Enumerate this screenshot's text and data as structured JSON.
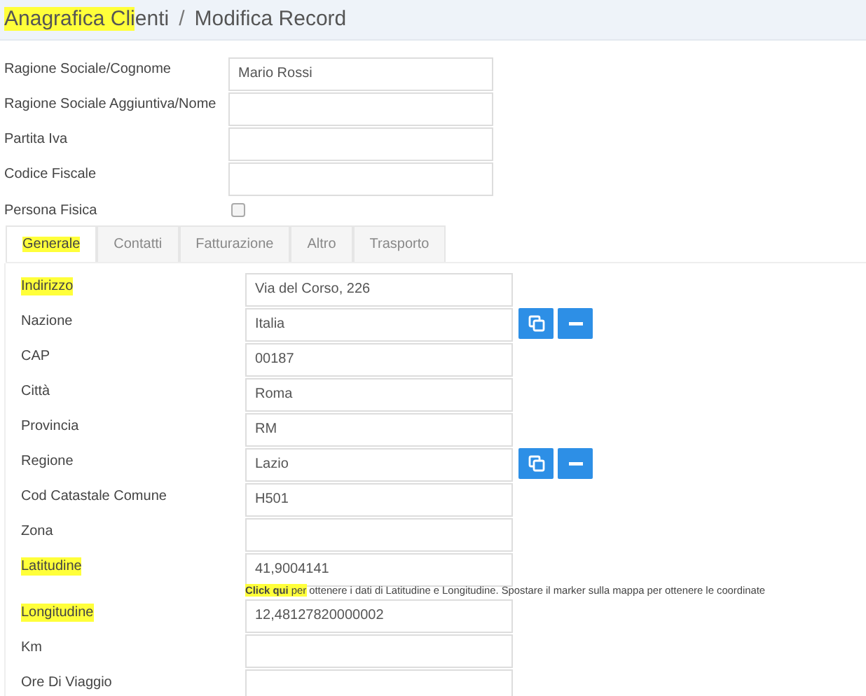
{
  "header": {
    "title_parts": [
      {
        "text": "Anagrafica Cli",
        "highlighted": true
      },
      {
        "text": "enti",
        "highlighted": false
      }
    ],
    "separator": "/",
    "subtitle": "Modifica Record"
  },
  "top_fields": [
    {
      "kind": "text",
      "label": "Ragione Sociale/Cognome",
      "value": "Mario Rossi"
    },
    {
      "kind": "text",
      "label": "Ragione Sociale Aggiuntiva/Nome"
    },
    {
      "kind": "text",
      "label": "Partita Iva"
    },
    {
      "kind": "text",
      "label": "Codice Fiscale"
    },
    {
      "kind": "checkbox",
      "label": "Persona Fisica",
      "checked": false
    }
  ],
  "tabs": [
    {
      "label": "Generale",
      "selected": true,
      "highlighted": true
    },
    {
      "label": "Contatti",
      "selected": false,
      "highlighted": false
    },
    {
      "label": "Fatturazione",
      "selected": false,
      "highlighted": false
    },
    {
      "label": "Altro",
      "selected": false,
      "highlighted": false
    },
    {
      "label": "Trasporto",
      "selected": false,
      "highlighted": false
    }
  ],
  "general_rows": [
    {
      "kind": "field",
      "label": "Indirizzo",
      "highlighted": true,
      "value": "Via del Corso, 226"
    },
    {
      "kind": "field",
      "label": "Nazione",
      "highlighted": false,
      "value": "Italia",
      "actions": [
        {
          "kind": "copy"
        },
        {
          "kind": "remove"
        }
      ]
    },
    {
      "kind": "field",
      "label": "CAP",
      "highlighted": false,
      "value": "00187"
    },
    {
      "kind": "field",
      "label": "Città",
      "highlighted": false,
      "value": "Roma"
    },
    {
      "kind": "field",
      "label": "Provincia",
      "highlighted": false,
      "value": "RM"
    },
    {
      "kind": "field",
      "label": "Regione",
      "highlighted": false,
      "value": "Lazio",
      "actions": [
        {
          "kind": "copy"
        },
        {
          "kind": "remove"
        }
      ]
    },
    {
      "kind": "field",
      "label": "Cod Catastale Comune",
      "highlighted": false,
      "value": "H501"
    },
    {
      "kind": "field",
      "label": "Zona",
      "highlighted": false
    },
    {
      "kind": "field",
      "label": "Latitudine",
      "highlighted": true,
      "value": "41,9004141"
    },
    {
      "kind": "help",
      "parts": [
        {
          "text": "Click qui",
          "bold": true,
          "highlighted": true
        },
        {
          "text": " per",
          "bold": false,
          "highlighted": true
        },
        {
          "text": " ottenere i dati di Latitudine e Longitudine. Spostare il marker sulla mappa per ottenere le coordinate",
          "bold": false,
          "highlighted": false
        }
      ]
    },
    {
      "kind": "field",
      "label": "Longitudine",
      "highlighted": true,
      "value": "12,48127820000002"
    },
    {
      "kind": "field",
      "label": "Km",
      "highlighted": false
    },
    {
      "kind": "field",
      "label": "Ore Di Viaggio",
      "highlighted": false
    }
  ]
}
